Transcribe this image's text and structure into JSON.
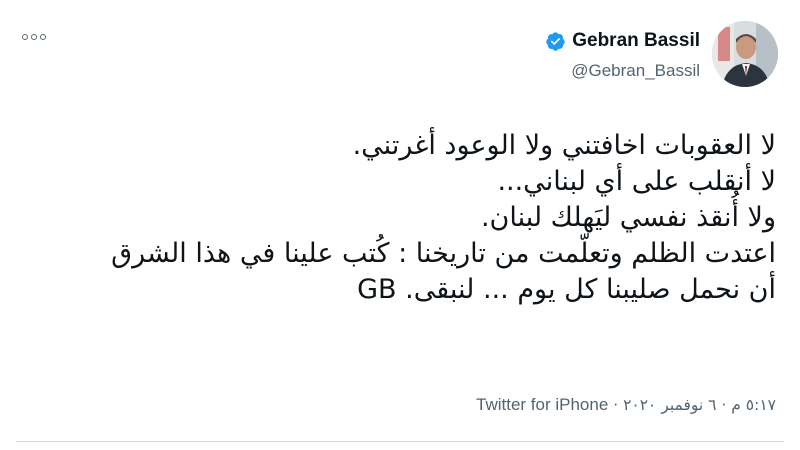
{
  "user": {
    "display_name": "Gebran Bassil",
    "handle": "@Gebran_Bassil",
    "verified": true,
    "verified_color": "#1d9bf0"
  },
  "tweet": {
    "lines": [
      "لا العقوبات اخافتني ولا الوعود أغرتني.",
      "لا أنقلب على أي لبناني...",
      "ولا أُنقذ نفسي ليَهلك لبنان.",
      "اعتدت الظلم وتعلّمت من تاريخنا : كُتب علينا في هذا الشرق",
      "أن نحمل صليبنا كل يوم ... لنبقى. GB"
    ]
  },
  "meta": {
    "timestamp": "٥:١٧ م · ٦ نوفمبر ٢٠٢٠",
    "separator": " · ",
    "source": "Twitter for iPhone"
  },
  "icons": {
    "more": "more-horizontal-icon",
    "verified": "verified-badge-icon"
  }
}
